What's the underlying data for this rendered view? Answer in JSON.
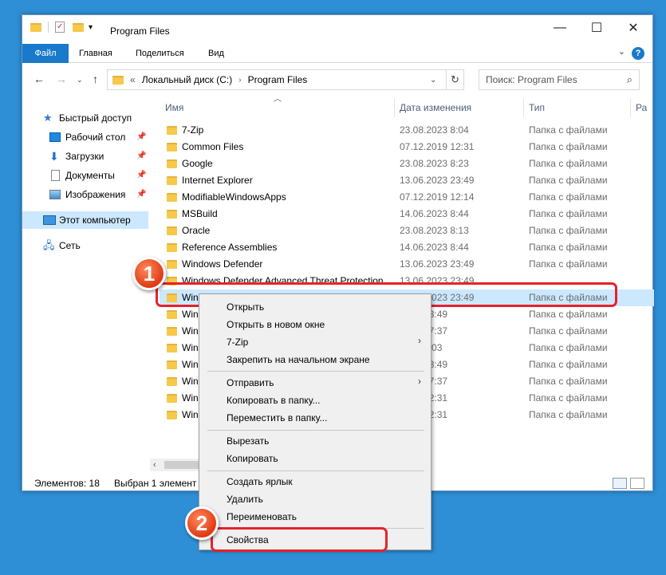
{
  "window": {
    "title": "Program Files",
    "controls": {
      "minimize": "—",
      "maximize": "☐",
      "close": "✕"
    }
  },
  "ribbon": {
    "tabs": [
      "Файл",
      "Главная",
      "Поделиться",
      "Вид"
    ],
    "help": "?"
  },
  "address": {
    "prefix": "«",
    "crumbs": [
      "Локальный диск (C:)",
      "Program Files"
    ],
    "search_placeholder": "Поиск: Program Files"
  },
  "nav_pane": {
    "items": [
      {
        "label": "Быстрый доступ",
        "icon": "star-icon"
      },
      {
        "label": "Рабочий стол",
        "icon": "desktop-icon",
        "pinned": true
      },
      {
        "label": "Загрузки",
        "icon": "download-icon",
        "pinned": true
      },
      {
        "label": "Документы",
        "icon": "documents-icon",
        "pinned": true
      },
      {
        "label": "Изображения",
        "icon": "pictures-icon",
        "pinned": true
      },
      {
        "label": "Этот компьютер",
        "icon": "computer-icon",
        "selected": true
      },
      {
        "label": "Сеть",
        "icon": "network-icon"
      }
    ]
  },
  "columns": {
    "name": "Имя",
    "date": "Дата изменения",
    "type": "Тип",
    "size": "Ра"
  },
  "files": [
    {
      "name": "7-Zip",
      "date": "23.08.2023 8:04",
      "type": "Папка с файлами"
    },
    {
      "name": "Common Files",
      "date": "07.12.2019 12:31",
      "type": "Папка с файлами"
    },
    {
      "name": "Google",
      "date": "23.08.2023 8:23",
      "type": "Папка с файлами"
    },
    {
      "name": "Internet Explorer",
      "date": "13.06.2023 23:49",
      "type": "Папка с файлами"
    },
    {
      "name": "ModifiableWindowsApps",
      "date": "07.12.2019 12:14",
      "type": "Папка с файлами"
    },
    {
      "name": "MSBuild",
      "date": "14.06.2023 8:44",
      "type": "Папка с файлами"
    },
    {
      "name": "Oracle",
      "date": "23.08.2023 8:13",
      "type": "Папка с файлами"
    },
    {
      "name": "Reference Assemblies",
      "date": "14.06.2023 8:44",
      "type": "Папка с файлами"
    },
    {
      "name": "Windows Defender",
      "date": "13.06.2023 23:49",
      "type": "Папка с файлами"
    },
    {
      "name": "Windows Defender Advanced Threat Protection",
      "date": "13.06.2023 23:49",
      "type": ""
    },
    {
      "name": "Windows Mail",
      "date": "13.06.2023 23:49",
      "type": "Папка с файлами",
      "selected": true
    },
    {
      "name": "Win",
      "date": "2023 23:49",
      "type": "Папка с файлами"
    },
    {
      "name": "Win",
      "date": "2023 17:37",
      "type": "Папка с файлами"
    },
    {
      "name": "Win",
      "date": "2023 8:03",
      "type": "Папка с файлами"
    },
    {
      "name": "Win",
      "date": "2023 23:49",
      "type": "Папка с файлами"
    },
    {
      "name": "Win",
      "date": "2023 17:37",
      "type": "Папка с файлами"
    },
    {
      "name": "Win",
      "date": "2019 12:31",
      "type": "Папка с файлами"
    },
    {
      "name": "Win",
      "date": "2019 12:31",
      "type": "Папка с файлами"
    }
  ],
  "status": {
    "count": "Элементов: 18",
    "selected": "Выбран 1 элемент"
  },
  "context_menu": {
    "groups": [
      [
        "Открыть",
        "Открыть в новом окне",
        "7-Zip",
        "Закрепить на начальном экране"
      ],
      [
        "Отправить",
        "Копировать в папку...",
        "Переместить в папку..."
      ],
      [
        "Вырезать",
        "Копировать"
      ],
      [
        "Создать ярлык",
        "Удалить",
        "Переименовать"
      ],
      [
        "Свойства"
      ]
    ]
  },
  "annotations": {
    "step1": "1",
    "step2": "2",
    "accent": "#e8212b"
  }
}
